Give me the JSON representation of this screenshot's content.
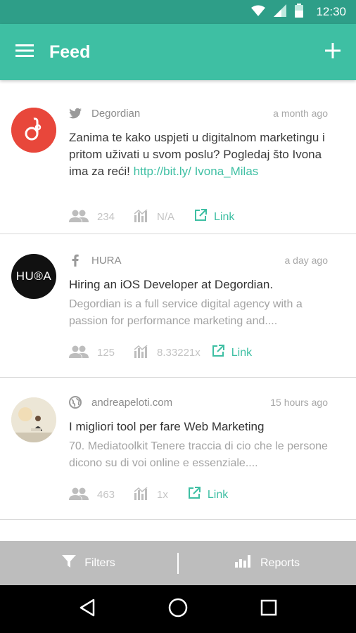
{
  "status_bar": {
    "time": "12:30"
  },
  "app_bar": {
    "title": "Feed"
  },
  "posts": [
    {
      "source": "Degordian",
      "time": "a month ago",
      "text": "Zanima te kako uspjeti u digitalnom marketingu i pritom uživati u svom poslu? Pogledaj što Ivona ima za reći! ",
      "link_text": "http://bit.ly/ Ivona_Milas",
      "followers": "234",
      "reach": "N/A",
      "link_label": "Link",
      "avatar_text": "d",
      "avatar_color": "#e8473b"
    },
    {
      "source": "HURA",
      "time": "a day ago",
      "title": "Hiring an iOS Developer at Degordian.",
      "desc": "Degordian is a full service digital agency with a passion for performance marketing and....",
      "followers": "125",
      "reach": "8.33221x",
      "link_label": "Link",
      "avatar_text": "HU®A",
      "avatar_color": "#111111"
    },
    {
      "source": "andreapeloti.com",
      "time": "15 hours ago",
      "title": "I migliori tool per fare Web Marketing",
      "desc": "70. Mediatoolkit Tenere traccia di cio che le persone dicono su di voi online e essenziale....",
      "followers": "463",
      "reach": "1x",
      "link_label": "Link"
    }
  ],
  "bottom_tabs": {
    "filters": "Filters",
    "reports": "Reports"
  },
  "colors": {
    "primary": "#3ebfa3",
    "primary_dark": "#2e9e88",
    "tab_bar": "#bdbdbd"
  }
}
